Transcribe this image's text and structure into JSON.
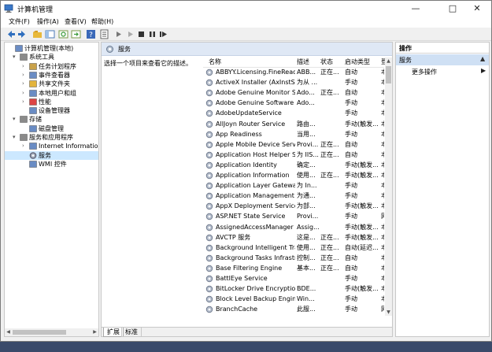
{
  "window": {
    "title": "计算机管理"
  },
  "menu": [
    "文件(F)",
    "操作(A)",
    "查看(V)",
    "帮助(H)"
  ],
  "tree": [
    {
      "label": "计算机管理(本地)",
      "exp": "",
      "level": 0,
      "name": "tree-item-computer-management"
    },
    {
      "label": "系统工具",
      "exp": "▾",
      "level": 1,
      "name": "tree-item-system-tools"
    },
    {
      "label": "任务计划程序",
      "exp": "›",
      "level": 2,
      "name": "tree-item-task-scheduler"
    },
    {
      "label": "事件查看器",
      "exp": "›",
      "level": 2,
      "name": "tree-item-event-viewer"
    },
    {
      "label": "共享文件夹",
      "exp": "›",
      "level": 2,
      "name": "tree-item-shared-folders"
    },
    {
      "label": "本地用户和组",
      "exp": "›",
      "level": 2,
      "name": "tree-item-local-users"
    },
    {
      "label": "性能",
      "exp": "›",
      "level": 2,
      "name": "tree-item-performance"
    },
    {
      "label": "设备管理器",
      "exp": "",
      "level": 2,
      "name": "tree-item-device-manager"
    },
    {
      "label": "存储",
      "exp": "▾",
      "level": 1,
      "name": "tree-item-storage"
    },
    {
      "label": "磁盘管理",
      "exp": "",
      "level": 2,
      "name": "tree-item-disk-management"
    },
    {
      "label": "服务和应用程序",
      "exp": "▾",
      "level": 1,
      "name": "tree-item-services-apps"
    },
    {
      "label": "Internet Information Se",
      "exp": "›",
      "level": 2,
      "name": "tree-item-iis"
    },
    {
      "label": "服务",
      "exp": "",
      "level": 2,
      "name": "tree-item-services",
      "selected": true
    },
    {
      "label": "WMI 控件",
      "exp": "",
      "level": 2,
      "name": "tree-item-wmi"
    }
  ],
  "center": {
    "header_title": "服务",
    "description_prompt": "选择一个项目来查看它的描述。",
    "columns": {
      "name": "名称",
      "desc": "描述",
      "status": "状态",
      "startup": "启动类型",
      "logon": "登"
    },
    "tabs": [
      "扩展",
      "标准"
    ]
  },
  "services": [
    {
      "name": "ABBYY.Licensing.FineRead...",
      "desc": "ABB...",
      "status": "正在...",
      "startup": "自动",
      "logon": "本"
    },
    {
      "name": "ActiveX Installer (AxInstSV)",
      "desc": "为从 ...",
      "status": "",
      "startup": "手动",
      "logon": "本"
    },
    {
      "name": "Adobe Genuine Monitor S...",
      "desc": "Ado...",
      "status": "正在...",
      "startup": "自动",
      "logon": "本"
    },
    {
      "name": "Adobe Genuine Software I...",
      "desc": "Ado...",
      "status": "",
      "startup": "手动",
      "logon": "本"
    },
    {
      "name": "AdobeUpdateService",
      "desc": "",
      "status": "",
      "startup": "手动",
      "logon": "本"
    },
    {
      "name": "AllJoyn Router Service",
      "desc": "路由...",
      "status": "",
      "startup": "手动(触发...",
      "logon": "本"
    },
    {
      "name": "App Readiness",
      "desc": "当用...",
      "status": "",
      "startup": "手动",
      "logon": "本"
    },
    {
      "name": "Apple Mobile Device Servi...",
      "desc": "Provi...",
      "status": "正在...",
      "startup": "自动",
      "logon": "本"
    },
    {
      "name": "Application Host Helper Se...",
      "desc": "为 IIS...",
      "status": "正在...",
      "startup": "自动",
      "logon": "本"
    },
    {
      "name": "Application Identity",
      "desc": "确定...",
      "status": "",
      "startup": "手动(触发...",
      "logon": "本"
    },
    {
      "name": "Application Information",
      "desc": "使用...",
      "status": "正在...",
      "startup": "手动(触发...",
      "logon": "本"
    },
    {
      "name": "Application Layer Gateway ...",
      "desc": "为 In...",
      "status": "",
      "startup": "手动",
      "logon": "本"
    },
    {
      "name": "Application Management",
      "desc": "为通...",
      "status": "",
      "startup": "手动",
      "logon": "本"
    },
    {
      "name": "AppX Deployment Service ...",
      "desc": "为部...",
      "status": "",
      "startup": "手动(触发...",
      "logon": "本"
    },
    {
      "name": "ASP.NET State Service",
      "desc": "Provi...",
      "status": "",
      "startup": "手动",
      "logon": "网"
    },
    {
      "name": "AssignedAccessManager ...",
      "desc": "Assig...",
      "status": "",
      "startup": "手动(触发...",
      "logon": "本"
    },
    {
      "name": "AVCTP 服务",
      "desc": "这是...",
      "status": "正在...",
      "startup": "手动(触发...",
      "logon": "本"
    },
    {
      "name": "Background Intelligent Tra...",
      "desc": "使用...",
      "status": "正在...",
      "startup": "自动(延迟...",
      "logon": "本"
    },
    {
      "name": "Background Tasks Infrastru...",
      "desc": "控制...",
      "status": "正在...",
      "startup": "自动",
      "logon": "本"
    },
    {
      "name": "Base Filtering Engine",
      "desc": "基本...",
      "status": "正在...",
      "startup": "自动",
      "logon": "本"
    },
    {
      "name": "BattlEye Service",
      "desc": "",
      "status": "",
      "startup": "手动",
      "logon": "本"
    },
    {
      "name": "BitLocker Drive Encryption ...",
      "desc": "BDE...",
      "status": "",
      "startup": "手动(触发...",
      "logon": "本"
    },
    {
      "name": "Block Level Backup Engine ...",
      "desc": "Win...",
      "status": "",
      "startup": "手动",
      "logon": "本"
    },
    {
      "name": "BranchCache",
      "desc": "此服...",
      "status": "",
      "startup": "手动",
      "logon": "网"
    }
  ],
  "actions": {
    "header": "操作",
    "section": "服务",
    "more": "更多操作"
  }
}
